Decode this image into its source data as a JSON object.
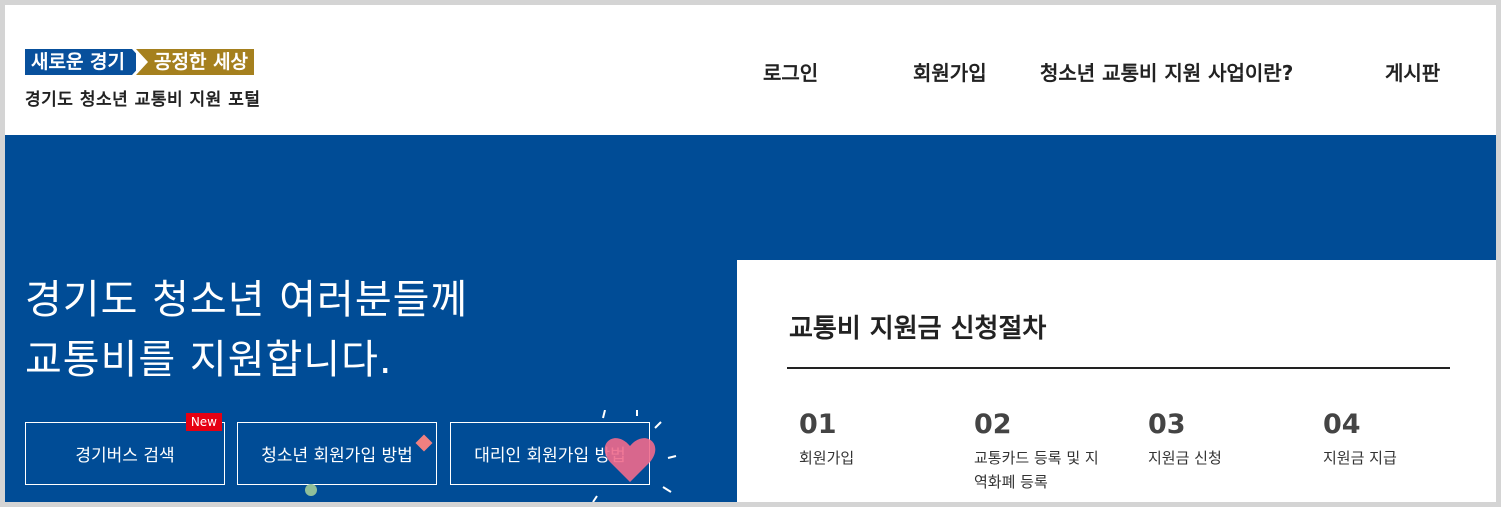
{
  "header": {
    "slogan_left": "새로운 경기",
    "slogan_right": "공정한 세상",
    "portal_name": "경기도 청소년 교통비 지원 포털"
  },
  "nav": {
    "items": [
      {
        "label": "로그인"
      },
      {
        "label": "회원가입"
      },
      {
        "label": "청소년 교통비 지원 사업이란?"
      },
      {
        "label": "게시판"
      }
    ]
  },
  "hero": {
    "headline_line1": "경기도 청소년 여러분들께",
    "headline_line2": "교통비를 지원합니다.",
    "buttons": [
      {
        "label": "경기버스 검색",
        "badge": "New"
      },
      {
        "label": "청소년 회원가입 방법"
      },
      {
        "label": "대리인 회원가입 방법"
      }
    ]
  },
  "procedure": {
    "title": "교통비 지원금 신청절차",
    "steps": [
      {
        "number": "01",
        "label": "회원가입"
      },
      {
        "number": "02",
        "label": "교통카드 등록 및 지역화폐 등록"
      },
      {
        "number": "03",
        "label": "지원금 신청"
      },
      {
        "number": "04",
        "label": "지원금 지급"
      }
    ]
  },
  "colors": {
    "brand_blue": "#004c96",
    "brand_gold": "#a5801e",
    "badge_red": "#e60012"
  }
}
